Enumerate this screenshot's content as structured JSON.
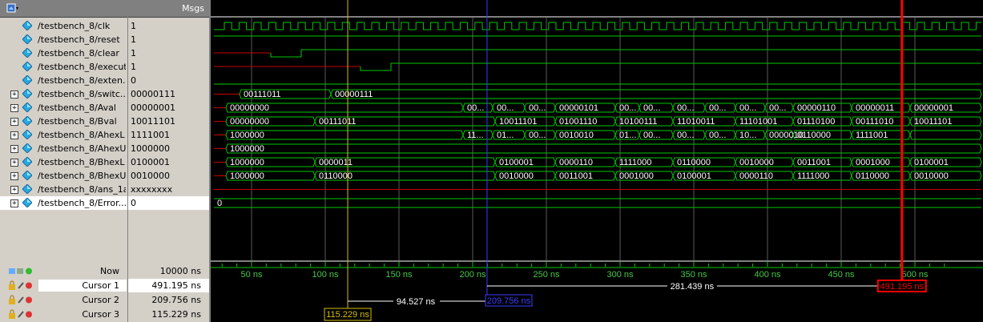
{
  "header": {
    "msgs_label": "Msgs"
  },
  "signals": [
    {
      "name": "/testbench_8/clk",
      "value": "1",
      "expandable": false
    },
    {
      "name": "/testbench_8/reset",
      "value": "1",
      "expandable": false
    },
    {
      "name": "/testbench_8/clear",
      "value": "1",
      "expandable": false
    },
    {
      "name": "/testbench_8/execute",
      "value": "1",
      "expandable": false
    },
    {
      "name": "/testbench_8/exten...",
      "value": "0",
      "expandable": false
    },
    {
      "name": "/testbench_8/switc...",
      "value": "00000111",
      "expandable": true
    },
    {
      "name": "/testbench_8/Aval",
      "value": "00000001",
      "expandable": true
    },
    {
      "name": "/testbench_8/Bval",
      "value": "10011101",
      "expandable": true
    },
    {
      "name": "/testbench_8/AhexL",
      "value": "1111001",
      "expandable": true
    },
    {
      "name": "/testbench_8/AhexU",
      "value": "1000000",
      "expandable": true
    },
    {
      "name": "/testbench_8/BhexL",
      "value": "0100001",
      "expandable": true
    },
    {
      "name": "/testbench_8/BhexU",
      "value": "0010000",
      "expandable": true
    },
    {
      "name": "/testbench_8/ans_1a",
      "value": "xxxxxxxx",
      "expandable": true
    },
    {
      "name": "/testbench_8/Error...",
      "value": "0",
      "expandable": true
    }
  ],
  "bottom": {
    "now_label": "Now",
    "now_value": "10000 ns",
    "cursors": [
      {
        "label": "Cursor 1",
        "value": "491.195 ns"
      },
      {
        "label": "Cursor 2",
        "value": "209.756 ns"
      },
      {
        "label": "Cursor 3",
        "value": "115.229 ns"
      }
    ]
  },
  "timeline": {
    "ticks": [
      "50 ns",
      "100 ns",
      "150 ns",
      "200 ns",
      "250 ns",
      "300 ns",
      "350 ns",
      "400 ns",
      "450 ns",
      "500 ns"
    ],
    "cursor1_time": "491.195 ns",
    "cursor2_time": "209.756 ns",
    "cursor3_time": "115.229 ns",
    "delta_1_2": "281.439 ns",
    "delta_2_3": "94.527 ns"
  },
  "bus_labels": {
    "switc": [
      "00111011",
      "00000111"
    ],
    "aval": [
      "00000000",
      "00...",
      "00...",
      "00...",
      "00000101",
      "00...",
      "00...",
      "00...",
      "00...",
      "00...",
      "00...",
      "00000110",
      "00000011",
      "00000001"
    ],
    "bval": [
      "00000000",
      "00111011",
      "10011101",
      "01001110",
      "10100111",
      "11010011",
      "11101001",
      "01110100",
      "00111010",
      "10011101"
    ],
    "ahexl": [
      "1000000",
      "11...",
      "01...",
      "00...",
      "0010010",
      "01...",
      "00...",
      "00...",
      "00...",
      "10...",
      "0000010",
      "0110000",
      "1111001"
    ],
    "ahexu": [
      "1000000"
    ],
    "bhexl": [
      "1000000",
      "0000011",
      "0100001",
      "0000110",
      "1111000",
      "0110000",
      "0010000",
      "0011001",
      "0001000",
      "0100001"
    ],
    "bhexu": [
      "1000000",
      "0110000",
      "0010000",
      "0011001",
      "0001000",
      "0100001",
      "0000110",
      "1111000",
      "0110000",
      "0010000"
    ],
    "error": [
      "0"
    ]
  },
  "colors": {
    "wave_green": "#00c800",
    "reset_red": "#c80000",
    "cursor1": "#ff0000",
    "cursor2": "#3c3cff",
    "cursor3": "#d4c000"
  }
}
